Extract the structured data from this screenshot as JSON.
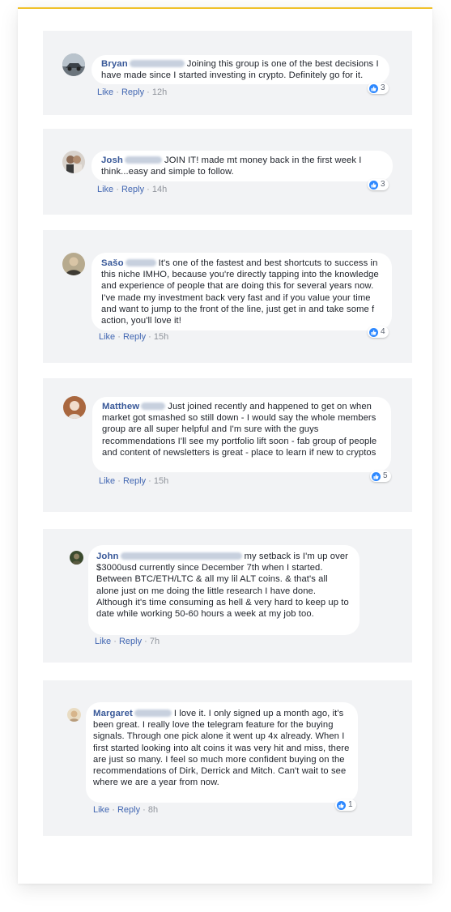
{
  "comments": [
    {
      "author": "Bryan",
      "text": "Joining this group is one of the best decisions I have made since I started investing in crypto. Definitely go for it.",
      "like_label": "Like",
      "reply_label": "Reply",
      "time": "12h",
      "reactions": "3"
    },
    {
      "author": "Josh",
      "text": "JOIN IT! made mt money back in the first week I think...easy and simple to follow.",
      "like_label": "Like",
      "reply_label": "Reply",
      "time": "14h",
      "reactions": "3"
    },
    {
      "author": "Sašo",
      "text": "It's one of the fastest and best shortcuts to success in this niche IMHO, because you're directly tapping into the knowledge and experience of people that are doing this for several years now. I've made my investment back very fast and if you value your time and want to jump to the front of the line, just get in and take some f action, you'll love it!",
      "like_label": "Like",
      "reply_label": "Reply",
      "time": "15h",
      "reactions": "4"
    },
    {
      "author": "Matthew",
      "text": "Just joined recently and happened to get on when market got smashed so still down - I would say the whole members group are all super helpful and I'm sure with the guys recommendations I'll see my portfolio lift soon - fab group of people and content of newsletters is great - place to learn if new to cryptos",
      "like_label": "Like",
      "reply_label": "Reply",
      "time": "15h",
      "reactions": "5"
    },
    {
      "author": "John",
      "text": "my setback is I'm up over $3000usd currently since December 7th when I started. Between BTC/ETH/LTC & all my lil ALT coins. & that's all alone just on me doing the little research I have done. Although it's time consuming as hell & very hard to keep up to date while working 50-60 hours a week at my job too.",
      "like_label": "Like",
      "reply_label": "Reply",
      "time": "7h",
      "reactions": ""
    },
    {
      "author": "Margaret",
      "text": "I love it. I only signed up a month ago, it's been great. I really love the telegram feature for the buying signals. Through one pick alone it went up 4x already. When I first started looking into alt coins it was very hit and miss, there are just so many. I feel so much more confident buying on the recommendations of Dirk, Derrick and Mitch. Can't wait to see where we are a year from now.",
      "like_label": "Like",
      "reply_label": "Reply",
      "time": "8h",
      "reactions": "1"
    }
  ],
  "separator": "·",
  "colors": {
    "accent_line": "#f0c12a",
    "panel_bg": "#f2f3f5",
    "author_link": "#385898",
    "action_link": "#4267b2",
    "like_badge": "#2d88ff"
  }
}
